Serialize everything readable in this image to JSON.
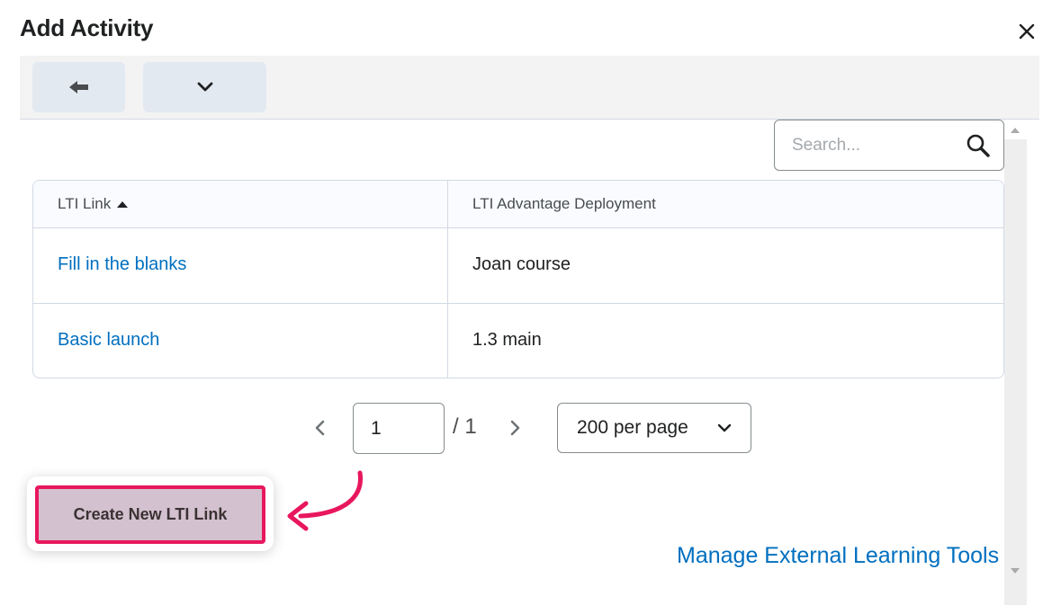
{
  "dialog": {
    "title": "Add Activity",
    "close_icon": "close-icon"
  },
  "toolbar": {
    "back_icon": "arrow-left-icon",
    "more_icon": "chevron-down-icon"
  },
  "search": {
    "placeholder": "Search...",
    "icon": "search-icon"
  },
  "table": {
    "columns": [
      "LTI Link",
      "LTI Advantage Deployment"
    ],
    "sort_icon": "sort-ascending-icon",
    "rows": [
      {
        "link": "Fill in the blanks",
        "deployment": "Joan course"
      },
      {
        "link": "Basic launch",
        "deployment": "1.3 main"
      }
    ]
  },
  "pagination": {
    "current_page": "1",
    "total_label": "/ 1",
    "per_page": "200 per page",
    "prev_icon": "chevron-left-icon",
    "next_icon": "chevron-right-icon"
  },
  "actions": {
    "create_label": "Create New LTI Link",
    "manage_label": "Manage External Learning Tools"
  },
  "colors": {
    "link": "#006fbf",
    "highlight_border": "#e8175d",
    "create_bg": "#d3c1cf"
  }
}
